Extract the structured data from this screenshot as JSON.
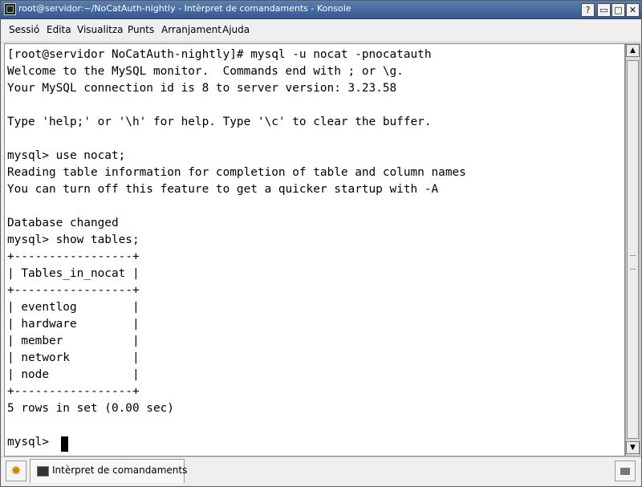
{
  "window": {
    "title": "root@servidor:~/NoCatAuth-nightly - Intèrpret de comandaments - Konsole",
    "buttons": {
      "help": "?",
      "minimize": "▭",
      "maximize": "□",
      "close": "✕"
    }
  },
  "menubar": {
    "items": [
      {
        "label": "Sessió"
      },
      {
        "label": "Edita"
      },
      {
        "label": "Visualitza"
      },
      {
        "label": "Punts"
      },
      {
        "label": "Arranjament"
      },
      {
        "label": "Ajuda"
      }
    ]
  },
  "terminal": {
    "lines": [
      "[root@servidor NoCatAuth-nightly]# mysql -u nocat -pnocatauth",
      "Welcome to the MySQL monitor.  Commands end with ; or \\g.",
      "Your MySQL connection id is 8 to server version: 3.23.58",
      "",
      "Type 'help;' or '\\h' for help. Type '\\c' to clear the buffer.",
      "",
      "mysql> use nocat;",
      "Reading table information for completion of table and column names",
      "You can turn off this feature to get a quicker startup with -A",
      "",
      "Database changed",
      "mysql> show tables;",
      "+-----------------+",
      "| Tables_in_nocat |",
      "+-----------------+",
      "| eventlog        |",
      "| hardware        |",
      "| member          |",
      "| network         |",
      "| node            |",
      "+-----------------+",
      "5 rows in set (0.00 sec)",
      "",
      "mysql> "
    ]
  },
  "tabbar": {
    "tabs": [
      {
        "label": "Intèrpret de comandaments"
      }
    ]
  },
  "icons": {
    "window": "terminal-icon",
    "new_session": "new-session-icon",
    "tab": "terminal-icon",
    "close_session": "close-session-icon"
  },
  "colors": {
    "titlebar": "#34578f",
    "terminal_bg": "#ffffff",
    "terminal_fg": "#000000"
  }
}
